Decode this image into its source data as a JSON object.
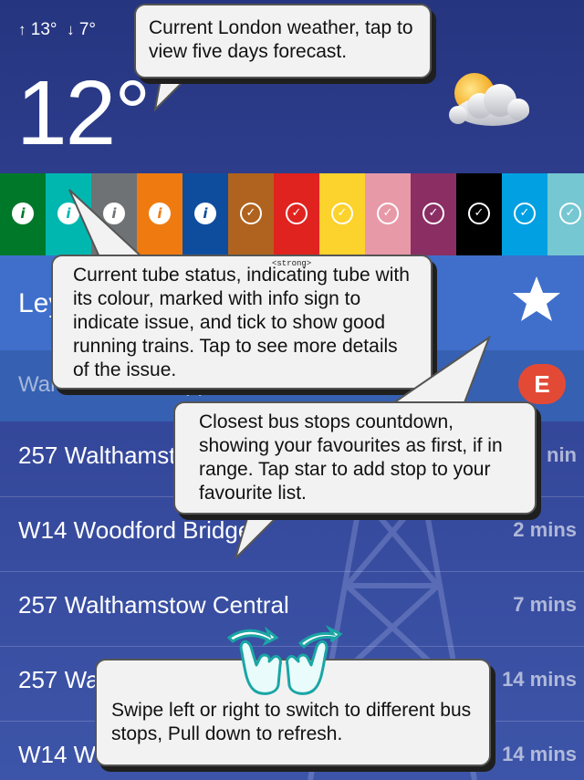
{
  "weather": {
    "high": "13°",
    "low": "7°",
    "current": "12°",
    "icon": "sun-behind-cloud-icon"
  },
  "tubes": [
    {
      "color": "#00782a",
      "status": "info"
    },
    {
      "color": "#00b7b0",
      "status": "info"
    },
    {
      "color": "#6f7275",
      "status": "info"
    },
    {
      "color": "#ef7b10",
      "status": "info"
    },
    {
      "color": "#0e4d9e",
      "status": "info"
    },
    {
      "color": "#b0631e",
      "status": "ok"
    },
    {
      "color": "#e0231f",
      "status": "ok"
    },
    {
      "color": "#fcd22c",
      "status": "ok"
    },
    {
      "color": "#e899a8",
      "status": "ok"
    },
    {
      "color": "#8b2e64",
      "status": "ok"
    },
    {
      "color": "#000000",
      "status": "ok"
    },
    {
      "color": "#00a0e2",
      "status": "ok"
    },
    {
      "color": "#75c7d2",
      "status": "ok"
    }
  ],
  "stop": {
    "name": "Ley",
    "towards": "Wanstead or Whipps Cross",
    "letter": "E"
  },
  "departures": [
    {
      "route": "257 Walthamst",
      "mins": "nin"
    },
    {
      "route": "W14 Woodford Bridge",
      "mins": "2 mins"
    },
    {
      "route": "257 Walthamstow Central",
      "mins": "7 mins"
    },
    {
      "route": "257 Walthamstow Central",
      "mins": "14 mins"
    },
    {
      "route": "W14 Woodford Bridge",
      "mins": "14 mins"
    }
  ],
  "tutorial": {
    "weather_tip": "Current London weather, tap to view five days forecast.",
    "tube_tip": "Current tube status, indicating tube with its colour, marked with info sign to indicate issue, and tick to show good running trains. Tap to see more details of the issue.",
    "tube_tip_tag": "<strong>",
    "bus_tip": "Closest bus stops countdown, showing your favourites as first, if in range. Tap star to add stop to your favourite list.",
    "swipe_tip": "Swipe left or right to switch to different bus stops, Pull down to refresh."
  },
  "colors": {
    "header_bg": "#2d3d8c",
    "stop_bg": "#3f6fcb",
    "towards_bg": "#3660b1",
    "letter_badge": "#e34a36"
  }
}
